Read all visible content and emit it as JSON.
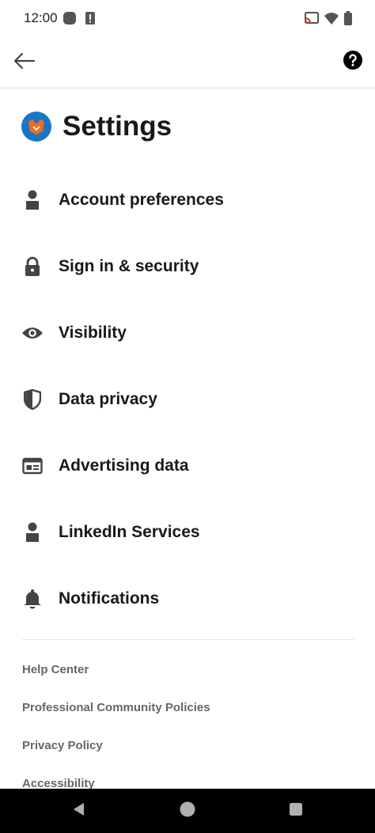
{
  "status_bar": {
    "time": "12:00",
    "icons": [
      "notification-dot-icon",
      "alert-icon",
      "cast-icon",
      "wifi-icon",
      "battery-icon"
    ]
  },
  "app_bar": {
    "back_icon": "arrow-left-icon",
    "help_icon": "question-circle-icon"
  },
  "header": {
    "title": "Settings",
    "logo": "brand-logo-icon"
  },
  "menu": {
    "items": [
      {
        "label": "Account preferences",
        "icon": "person-icon"
      },
      {
        "label": "Sign in & security",
        "icon": "lock-icon"
      },
      {
        "label": "Visibility",
        "icon": "eye-icon"
      },
      {
        "label": "Data privacy",
        "icon": "shield-icon"
      },
      {
        "label": "Advertising data",
        "icon": "ad-card-icon"
      },
      {
        "label": "LinkedIn Services",
        "icon": "person-icon"
      },
      {
        "label": "Notifications",
        "icon": "bell-icon"
      }
    ]
  },
  "footer": {
    "links": [
      "Help Center",
      "Professional Community Policies",
      "Privacy Policy",
      "Accessibility"
    ]
  },
  "nav_bar": {
    "icons": [
      "back-triangle-icon",
      "home-circle-icon",
      "recents-square-icon"
    ]
  },
  "colors": {
    "text_primary": "#191919",
    "text_secondary": "#666666",
    "icon": "#444444",
    "brand_blue": "#1976c5",
    "brand_orange": "#f26b21"
  }
}
